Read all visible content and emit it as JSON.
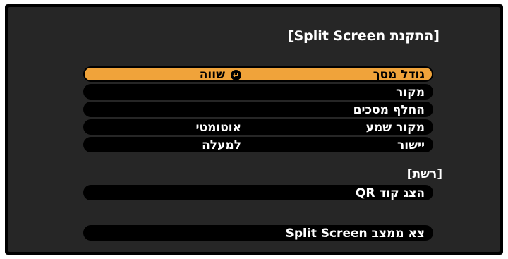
{
  "title": "[התקנת Split Screen]",
  "rows": [
    {
      "label": "גודל מסך",
      "value": "שווה",
      "icon": "enter-icon"
    },
    {
      "label": "מקור",
      "value": ""
    },
    {
      "label": "החלף מסכים",
      "value": ""
    },
    {
      "label": "מקור שמע",
      "value": "אוטומטי"
    },
    {
      "label": "יישור",
      "value": "למעלה"
    }
  ],
  "network_heading": "[רשת]",
  "show_qr_label": "הצג קוד QR",
  "exit_label": "צא ממצב Split Screen",
  "colors": {
    "highlight": "#f0a33a",
    "panel": "#262626",
    "row": "#000000",
    "text": "#ffffff"
  }
}
